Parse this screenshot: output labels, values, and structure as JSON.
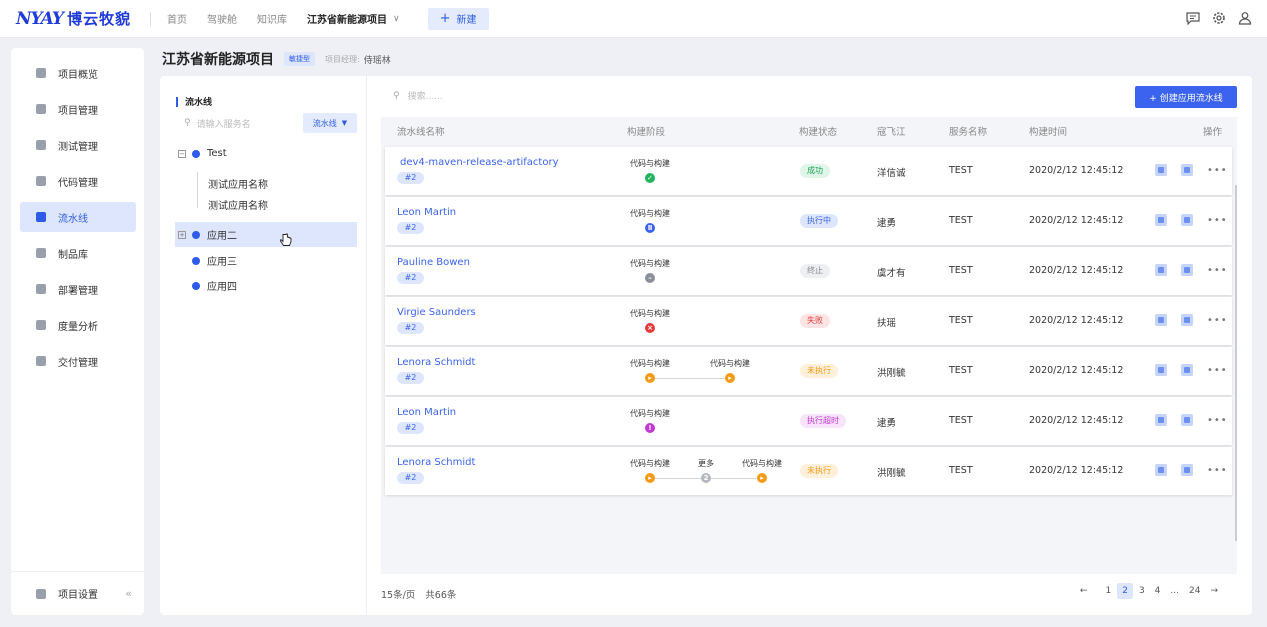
{
  "topbar": {
    "logo_mark": "NYAY",
    "logo_text": "博云牧貌",
    "nav": [
      "首页",
      "驾驶舱",
      "知识库"
    ],
    "project": "江苏省新能源项目",
    "new_label": "新建",
    "icons": [
      "message-icon",
      "gear-icon",
      "user-icon"
    ]
  },
  "sidebar": {
    "items": [
      {
        "label": "项目概览",
        "icon": "overview-icon"
      },
      {
        "label": "项目管理",
        "icon": "grid-icon"
      },
      {
        "label": "测试管理",
        "icon": "test-icon"
      },
      {
        "label": "代码管理",
        "icon": "code-icon"
      },
      {
        "label": "流水线",
        "icon": "pipeline-icon",
        "active": true
      },
      {
        "label": "制品库",
        "icon": "package-icon"
      },
      {
        "label": "部署管理",
        "icon": "deploy-icon"
      },
      {
        "label": "度量分析",
        "icon": "chart-icon"
      },
      {
        "label": "交付管理",
        "icon": "delivery-icon"
      }
    ],
    "settings_label": "项目设置",
    "collapse_glyph": "«"
  },
  "header": {
    "title": "江苏省新能源项目",
    "tag": "敏捷型",
    "pm_label": "项目经理:",
    "pm_name": "侍瑶林"
  },
  "tree": {
    "title": "流水线",
    "search_placeholder": "请输入服务名",
    "select_value": "流水线",
    "nodes": [
      {
        "label": "Test",
        "children": [
          "测试应用名称",
          "测试应用名称"
        ]
      },
      {
        "label": "应用二",
        "selected": true
      },
      {
        "label": "应用三"
      },
      {
        "label": "应用四"
      }
    ]
  },
  "content": {
    "search_placeholder": "搜索......",
    "create_label": "+ 创建应用流水线",
    "columns": [
      "流水线名称",
      "构建阶段",
      "构建状态",
      "寇飞江",
      "服务名称",
      "构建时间",
      "操作"
    ],
    "rows": [
      {
        "name": "dev4-maven-release-artifactory",
        "num": "#2",
        "stages": [
          {
            "label": "代码与构建",
            "state": "success",
            "glyph": "✓"
          }
        ],
        "status": "成功",
        "status_type": "success",
        "builder": "洋信诚",
        "service": "TEST",
        "time": "2020/2/12  12:45:12"
      },
      {
        "name": "Leon Martin",
        "num": "#2",
        "stages": [
          {
            "label": "代码与构建",
            "state": "running",
            "glyph": "Ⅱ"
          }
        ],
        "status": "执行中",
        "status_type": "running",
        "builder": "逮勇",
        "service": "TEST",
        "time": "2020/2/12  12:45:12"
      },
      {
        "name": "Pauline Bowen",
        "num": "#2",
        "stages": [
          {
            "label": "代码与构建",
            "state": "stopped",
            "glyph": "–"
          }
        ],
        "status": "终止",
        "status_type": "stopped",
        "builder": "虞才有",
        "service": "TEST",
        "time": "2020/2/12  12:45:12"
      },
      {
        "name": "Virgie Saunders",
        "num": "#2",
        "stages": [
          {
            "label": "代码与构建",
            "state": "failed",
            "glyph": "×"
          }
        ],
        "status": "失败",
        "status_type": "failed",
        "builder": "扶瑶",
        "service": "TEST",
        "time": "2020/2/12  12:45:12"
      },
      {
        "name": "Lenora Schmidt",
        "num": "#2",
        "stages": [
          {
            "label": "代码与构建",
            "state": "notrun",
            "glyph": "▸"
          },
          {
            "label": "代码与构建",
            "state": "notrun",
            "glyph": "▸"
          }
        ],
        "status": "未执行",
        "status_type": "notrun",
        "builder": "洪刚毓",
        "service": "TEST",
        "time": "2020/2/12  12:45:12"
      },
      {
        "name": "Leon Martin",
        "num": "#2",
        "stages": [
          {
            "label": "代码与构建",
            "state": "timeout",
            "glyph": "!"
          }
        ],
        "status": "执行超时",
        "status_type": "timeout",
        "builder": "逮勇",
        "service": "TEST",
        "time": "2020/2/12  12:45:12"
      },
      {
        "name": "Lenora Schmidt",
        "num": "#2",
        "stages": [
          {
            "label": "代码与构建",
            "state": "notrun",
            "glyph": "▸"
          },
          {
            "label": "更多",
            "state": "more",
            "glyph": "2"
          },
          {
            "label": "代码与构建",
            "state": "notrun",
            "glyph": "▸"
          }
        ],
        "status": "未执行",
        "status_type": "notrun",
        "builder": "洪刚毓",
        "service": "TEST",
        "time": "2020/2/12  12:45:12"
      }
    ],
    "colors": {
      "success": "#22b35e",
      "running": "#3b63f0",
      "stopped": "#8a8f99",
      "failed": "#e53b3b",
      "notrun": "#f59a14",
      "timeout": "#c03ad2",
      "more": "#b5b8c0"
    }
  },
  "footer": {
    "per_page": "15条/页",
    "total": "共66条",
    "prev": "←",
    "pages": [
      "1",
      "2",
      "3",
      "4",
      "...",
      "24"
    ],
    "active_page": "2",
    "next": "→"
  }
}
